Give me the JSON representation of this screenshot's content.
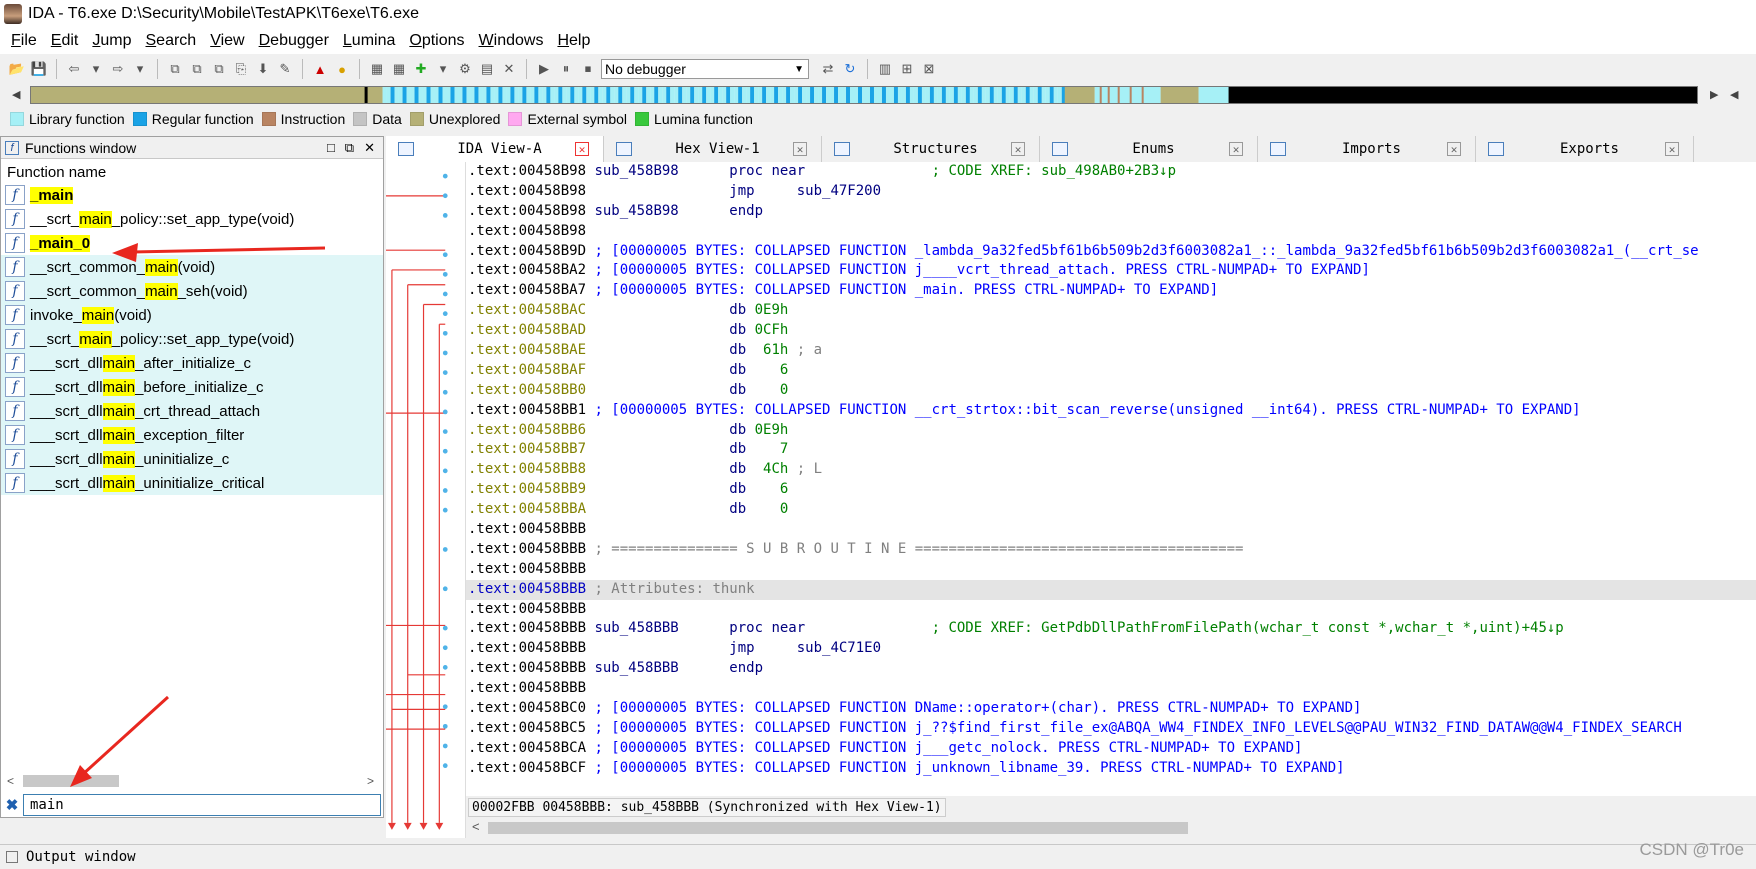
{
  "window": {
    "title": "IDA - T6.exe D:\\Security\\Mobile\\TestAPK\\T6exe\\T6.exe"
  },
  "menu": [
    {
      "label": "File",
      "u": "F",
      "rest": "ile"
    },
    {
      "label": "Edit",
      "u": "E",
      "rest": "dit"
    },
    {
      "label": "Jump",
      "u": "J",
      "rest": "ump"
    },
    {
      "label": "Search",
      "u": "S",
      "rest": "earch"
    },
    {
      "label": "View",
      "u": "V",
      "rest": "iew"
    },
    {
      "label": "Debugger",
      "u": "D",
      "rest": "ebugger"
    },
    {
      "label": "Lumina",
      "u": "L",
      "rest": "umina"
    },
    {
      "label": "Options",
      "u": "O",
      "rest": "ptions"
    },
    {
      "label": "Windows",
      "u": "W",
      "rest": "indows"
    },
    {
      "label": "Help",
      "u": "H",
      "rest": "elp"
    }
  ],
  "toolbar": {
    "debugger_select": "No debugger"
  },
  "legend": [
    {
      "label": "Library function",
      "color": "#a6f0f6"
    },
    {
      "label": "Regular function",
      "color": "#1aa3e6"
    },
    {
      "label": "Instruction",
      "color": "#b98462"
    },
    {
      "label": "Data",
      "color": "#c4c4c4"
    },
    {
      "label": "Unexplored",
      "color": "#b5b076"
    },
    {
      "label": "External symbol",
      "color": "#ffa8f0"
    },
    {
      "label": "Lumina function",
      "color": "#38c83c"
    }
  ],
  "functions_window": {
    "title": "Functions window",
    "column_header": "Function name",
    "filter_value": "main",
    "rows": [
      {
        "pre": "",
        "hl": "_main",
        "post": "",
        "bold": true,
        "alt": false
      },
      {
        "pre": "__scrt_",
        "hl": "main",
        "post": "_policy::set_app_type(void)",
        "bold": false,
        "alt": false
      },
      {
        "pre": "",
        "hl": "_main_0",
        "post": "",
        "bold": true,
        "alt": false
      },
      {
        "pre": "__scrt_common_",
        "hl": "main",
        "post": "(void)",
        "bold": false,
        "alt": true
      },
      {
        "pre": "__scrt_common_",
        "hl": "main",
        "post": "_seh(void)",
        "bold": false,
        "alt": true
      },
      {
        "pre": "invoke_",
        "hl": "main",
        "post": "(void)",
        "bold": false,
        "alt": true
      },
      {
        "pre": "__scrt_",
        "hl": "main",
        "post": "_policy::set_app_type(void)",
        "bold": false,
        "alt": true
      },
      {
        "pre": "___scrt_dll",
        "hl": "main",
        "post": "_after_initialize_c",
        "bold": false,
        "alt": true
      },
      {
        "pre": "___scrt_dll",
        "hl": "main",
        "post": "_before_initialize_c",
        "bold": false,
        "alt": true
      },
      {
        "pre": "___scrt_dll",
        "hl": "main",
        "post": "_crt_thread_attach",
        "bold": false,
        "alt": true
      },
      {
        "pre": "___scrt_dll",
        "hl": "main",
        "post": "_exception_filter",
        "bold": false,
        "alt": true
      },
      {
        "pre": "___scrt_dll",
        "hl": "main",
        "post": "_uninitialize_c",
        "bold": false,
        "alt": true
      },
      {
        "pre": "___scrt_dll",
        "hl": "main",
        "post": "_uninitialize_critical",
        "bold": false,
        "alt": true
      }
    ]
  },
  "tabs": [
    {
      "label": "IDA View-A",
      "active": true,
      "icon": "ida-view-icon"
    },
    {
      "label": "Hex View-1",
      "active": false,
      "icon": "hex-view-icon"
    },
    {
      "label": "Structures",
      "active": false,
      "icon": "structures-icon"
    },
    {
      "label": "Enums",
      "active": false,
      "icon": "enums-icon"
    },
    {
      "label": "Imports",
      "active": false,
      "icon": "imports-icon"
    },
    {
      "label": "Exports",
      "active": false,
      "icon": "exports-icon"
    }
  ],
  "disasm": [
    [
      [
        "c-addr",
        ".text:00458B98 "
      ],
      [
        "c-name",
        "sub_458B98      "
      ],
      [
        "c-kw",
        "proc near"
      ],
      [
        "c-cmt",
        "               ; CODE XREF: sub_498AB0+2B3↓p"
      ]
    ],
    [
      [
        "c-addr",
        ".text:00458B98                 "
      ],
      [
        "c-kw",
        "jmp     "
      ],
      [
        "c-name",
        "sub_47F200"
      ]
    ],
    [
      [
        "c-addr",
        ".text:00458B98 "
      ],
      [
        "c-name",
        "sub_458B98      "
      ],
      [
        "c-kw",
        "endp"
      ]
    ],
    [
      [
        "c-addr",
        ".text:00458B98"
      ]
    ],
    [
      [
        "c-addr",
        ".text:00458B9D "
      ],
      [
        "c-blue",
        "; [00000005 BYTES: COLLAPSED FUNCTION _lambda_9a32fed5bf61b6b509b2d3f6003082a1_::_lambda_9a32fed5bf61b6b509b2d3f6003082a1_(__crt_se"
      ]
    ],
    [
      [
        "c-addr",
        ".text:00458BA2 "
      ],
      [
        "c-blue",
        "; [00000005 BYTES: COLLAPSED FUNCTION j____vcrt_thread_attach. PRESS CTRL-NUMPAD+ TO EXPAND]"
      ]
    ],
    [
      [
        "c-addr",
        ".text:00458BA7 "
      ],
      [
        "c-blue",
        "; [00000005 BYTES: COLLAPSED FUNCTION _main. PRESS CTRL-NUMPAD+ TO EXPAND]"
      ]
    ],
    [
      [
        "c-addr-d",
        ".text:00458BAC                 "
      ],
      [
        "c-kw",
        "db "
      ],
      [
        "c-op",
        "0E9h"
      ]
    ],
    [
      [
        "c-addr-d",
        ".text:00458BAD                 "
      ],
      [
        "c-kw",
        "db "
      ],
      [
        "c-op",
        "0CFh"
      ]
    ],
    [
      [
        "c-addr-d",
        ".text:00458BAE                 "
      ],
      [
        "c-kw",
        "db  "
      ],
      [
        "c-op",
        "61h"
      ],
      [
        "c-gray",
        " ; a"
      ]
    ],
    [
      [
        "c-addr-d",
        ".text:00458BAF                 "
      ],
      [
        "c-kw",
        "db    "
      ],
      [
        "c-op",
        "6"
      ]
    ],
    [
      [
        "c-addr-d",
        ".text:00458BB0                 "
      ],
      [
        "c-kw",
        "db    "
      ],
      [
        "c-op",
        "0"
      ]
    ],
    [
      [
        "c-addr",
        ".text:00458BB1 "
      ],
      [
        "c-blue",
        "; [00000005 BYTES: COLLAPSED FUNCTION __crt_strtox::bit_scan_reverse(unsigned __int64). PRESS CTRL-NUMPAD+ TO EXPAND]"
      ]
    ],
    [
      [
        "c-addr-d",
        ".text:00458BB6                 "
      ],
      [
        "c-kw",
        "db "
      ],
      [
        "c-op",
        "0E9h"
      ]
    ],
    [
      [
        "c-addr-d",
        ".text:00458BB7                 "
      ],
      [
        "c-kw",
        "db    "
      ],
      [
        "c-op",
        "7"
      ]
    ],
    [
      [
        "c-addr-d",
        ".text:00458BB8                 "
      ],
      [
        "c-kw",
        "db  "
      ],
      [
        "c-op",
        "4Ch"
      ],
      [
        "c-gray",
        " ; L"
      ]
    ],
    [
      [
        "c-addr-d",
        ".text:00458BB9                 "
      ],
      [
        "c-kw",
        "db    "
      ],
      [
        "c-op",
        "6"
      ]
    ],
    [
      [
        "c-addr-d",
        ".text:00458BBA                 "
      ],
      [
        "c-kw",
        "db    "
      ],
      [
        "c-op",
        "0"
      ]
    ],
    [
      [
        "c-addr",
        ".text:00458BBB"
      ]
    ],
    [
      [
        "c-addr",
        ".text:00458BBB "
      ],
      [
        "c-gray",
        "; =============== S U B R O U T I N E ======================================="
      ]
    ],
    [
      [
        "c-addr",
        ".text:00458BBB"
      ]
    ],
    [
      [
        "c-addr-sel",
        ".text:00458BBB "
      ],
      [
        "c-gray",
        "; Attributes: thunk"
      ]
    ],
    [
      [
        "c-addr",
        ".text:00458BBB"
      ]
    ],
    [
      [
        "c-addr",
        ".text:00458BBB "
      ],
      [
        "c-name",
        "sub_458BBB      "
      ],
      [
        "c-kw",
        "proc near"
      ],
      [
        "c-cmt",
        "               ; CODE XREF: GetPdbDllPathFromFilePath(wchar_t const *,wchar_t *,uint)+45↓p"
      ]
    ],
    [
      [
        "c-addr",
        ".text:00458BBB                 "
      ],
      [
        "c-kw",
        "jmp     "
      ],
      [
        "c-name",
        "sub_4C71E0"
      ]
    ],
    [
      [
        "c-addr",
        ".text:00458BBB "
      ],
      [
        "c-name",
        "sub_458BBB      "
      ],
      [
        "c-kw",
        "endp"
      ]
    ],
    [
      [
        "c-addr",
        ".text:00458BBB"
      ]
    ],
    [
      [
        "c-addr",
        ".text:00458BC0 "
      ],
      [
        "c-blue",
        "; [00000005 BYTES: COLLAPSED FUNCTION DName::operator+(char). PRESS CTRL-NUMPAD+ TO EXPAND]"
      ]
    ],
    [
      [
        "c-addr",
        ".text:00458BC5 "
      ],
      [
        "c-blue",
        "; [00000005 BYTES: COLLAPSED FUNCTION j_??$find_first_file_ex@ABQA_WW4_FINDEX_INFO_LEVELS@@PAU_WIN32_FIND_DATAW@@W4_FINDEX_SEARCH"
      ]
    ],
    [
      [
        "c-addr",
        ".text:00458BCA "
      ],
      [
        "c-blue",
        "; [00000005 BYTES: COLLAPSED FUNCTION j___getc_nolock. PRESS CTRL-NUMPAD+ TO EXPAND]"
      ]
    ],
    [
      [
        "c-addr",
        ".text:00458BCF "
      ],
      [
        "c-blue",
        "; [00000005 BYTES: COLLAPSED FUNCTION j_unknown_libname_39. PRESS CTRL-NUMPAD+ TO EXPAND]"
      ]
    ]
  ],
  "highlight_row": 21,
  "status": "00002FBB 00458BBB: sub_458BBB (Synchronized with Hex View-1)",
  "output_window": "Output window",
  "watermark": "CSDN @Tr0e"
}
